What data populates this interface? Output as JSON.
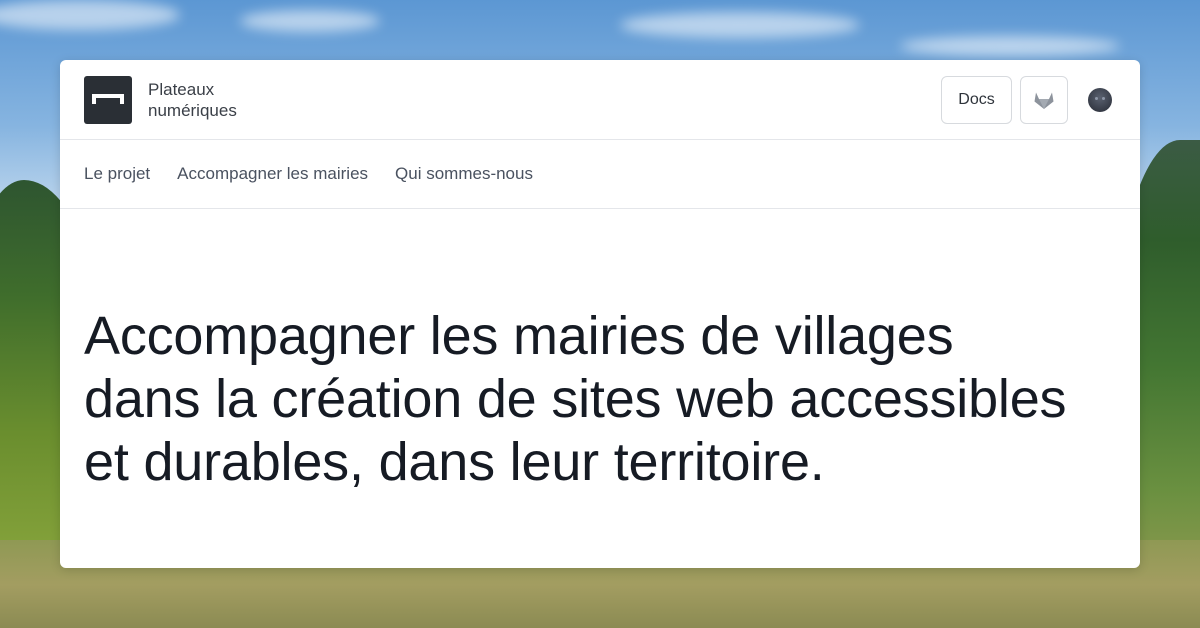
{
  "site": {
    "brand_line1": "Plateaux",
    "brand_line2": "numériques"
  },
  "header": {
    "docs_label": "Docs",
    "gitlab_icon": "gitlab-icon",
    "avatar_icon": "user-avatar"
  },
  "nav": {
    "items": [
      {
        "label": "Le projet"
      },
      {
        "label": "Accompagner les mairies"
      },
      {
        "label": "Qui sommes-nous"
      }
    ]
  },
  "hero": {
    "lines": [
      "Accompagner les mairies de villages",
      "dans la création de sites web accessibles",
      "et durables, dans leur territoire."
    ]
  },
  "colors": {
    "logo_bg": "#2a2f35",
    "text_dark": "#161b24",
    "nav_text": "#4a5260",
    "border": "#e4e6ea"
  }
}
